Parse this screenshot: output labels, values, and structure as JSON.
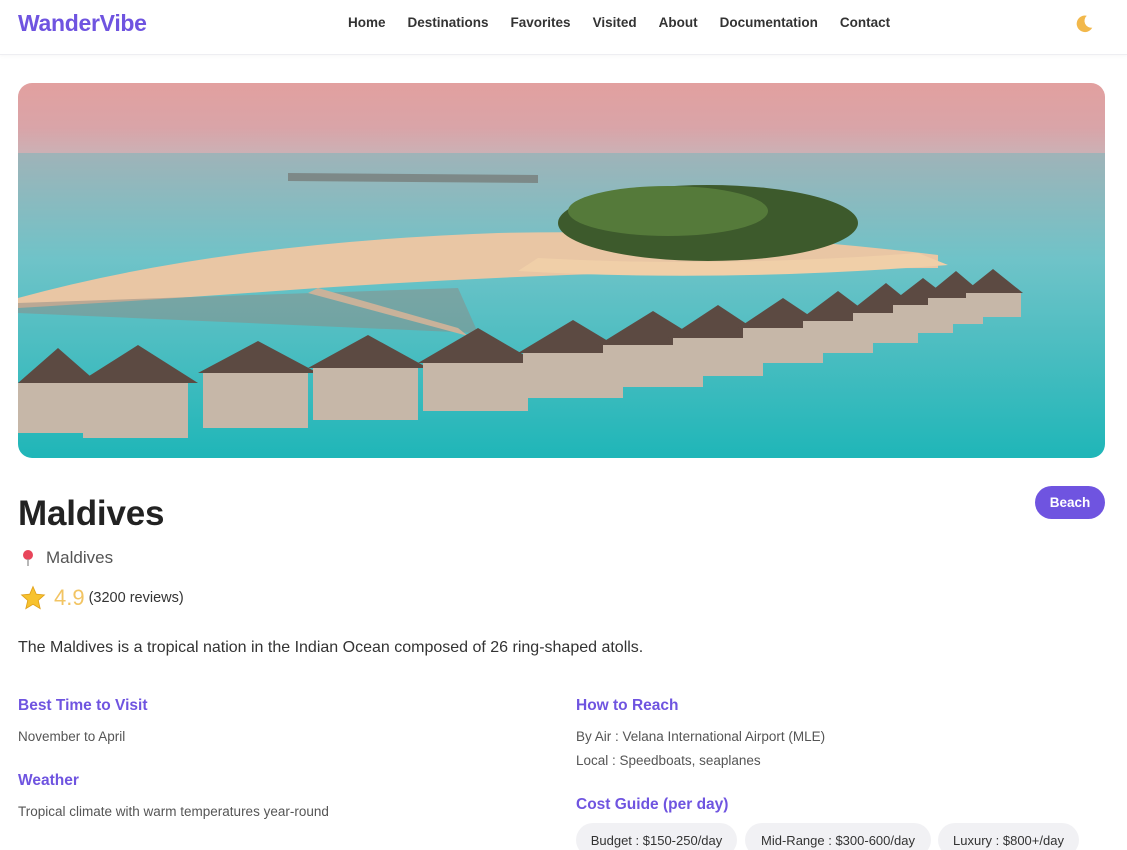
{
  "nav": {
    "brand": "WanderVibe",
    "links": [
      "Home",
      "Destinations",
      "Favorites",
      "Visited",
      "About",
      "Documentation",
      "Contact"
    ],
    "theme_icon": "moon-icon"
  },
  "destination": {
    "name": "Maldives",
    "category": "Beach",
    "location": "Maldives",
    "location_icon": "pin-icon",
    "rating": "4.9",
    "reviews": "(3200 reviews)",
    "rating_icon": "star-icon",
    "description": "The Maldives is a tropical nation in the Indian Ocean composed of 26 ring-shaped atolls."
  },
  "details": {
    "best_time_title": "Best Time to Visit",
    "best_time": "November to April",
    "weather_title": "Weather",
    "weather": "Tropical climate with warm temperatures year-round",
    "how_to_reach_title": "How to Reach",
    "by_air": "By Air : Velana International Airport (MLE)",
    "local": "Local : Speedboats, seaplanes",
    "cost_title": "Cost Guide (per day)",
    "costs": [
      "Budget : $150-250/day",
      "Mid-Range : $300-600/day",
      "Luxury : $800+/day"
    ]
  },
  "colors": {
    "accent": "#6f54e0",
    "rating": "#f2c463"
  }
}
